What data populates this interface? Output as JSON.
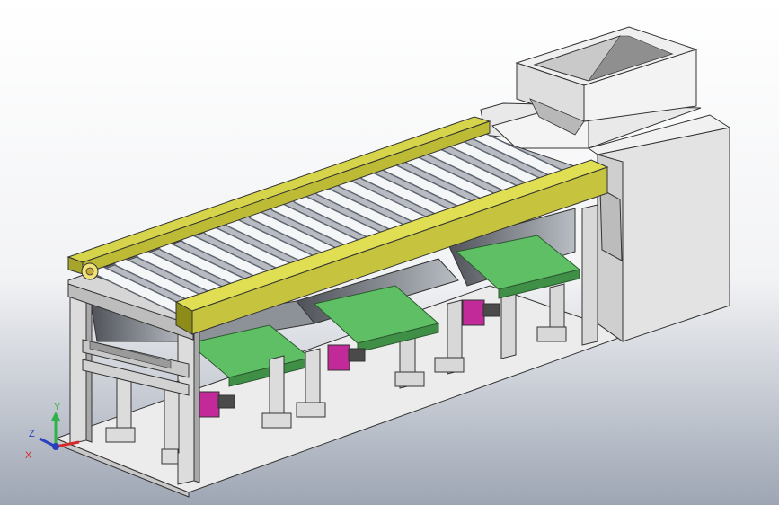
{
  "viewport": {
    "background_top": "#ffffff",
    "background_bottom": "#9ea6b4"
  },
  "colors": {
    "rail": "#c6c43e",
    "rail_dark": "#8d8b1a",
    "belt": "#5fbf65",
    "belt_dark": "#3f8f47",
    "motor": "#c22a9a",
    "frame": "#d8d8d8",
    "frame_dark": "#9a9a9a",
    "base": "#ececec",
    "roller": "#f4f6f8"
  },
  "triad": {
    "y_label": "Y",
    "z_label": "Z",
    "x_label": "X",
    "y_color": "#2fb24a",
    "z_color": "#2a3fbf",
    "x_color": "#d42a2a"
  }
}
